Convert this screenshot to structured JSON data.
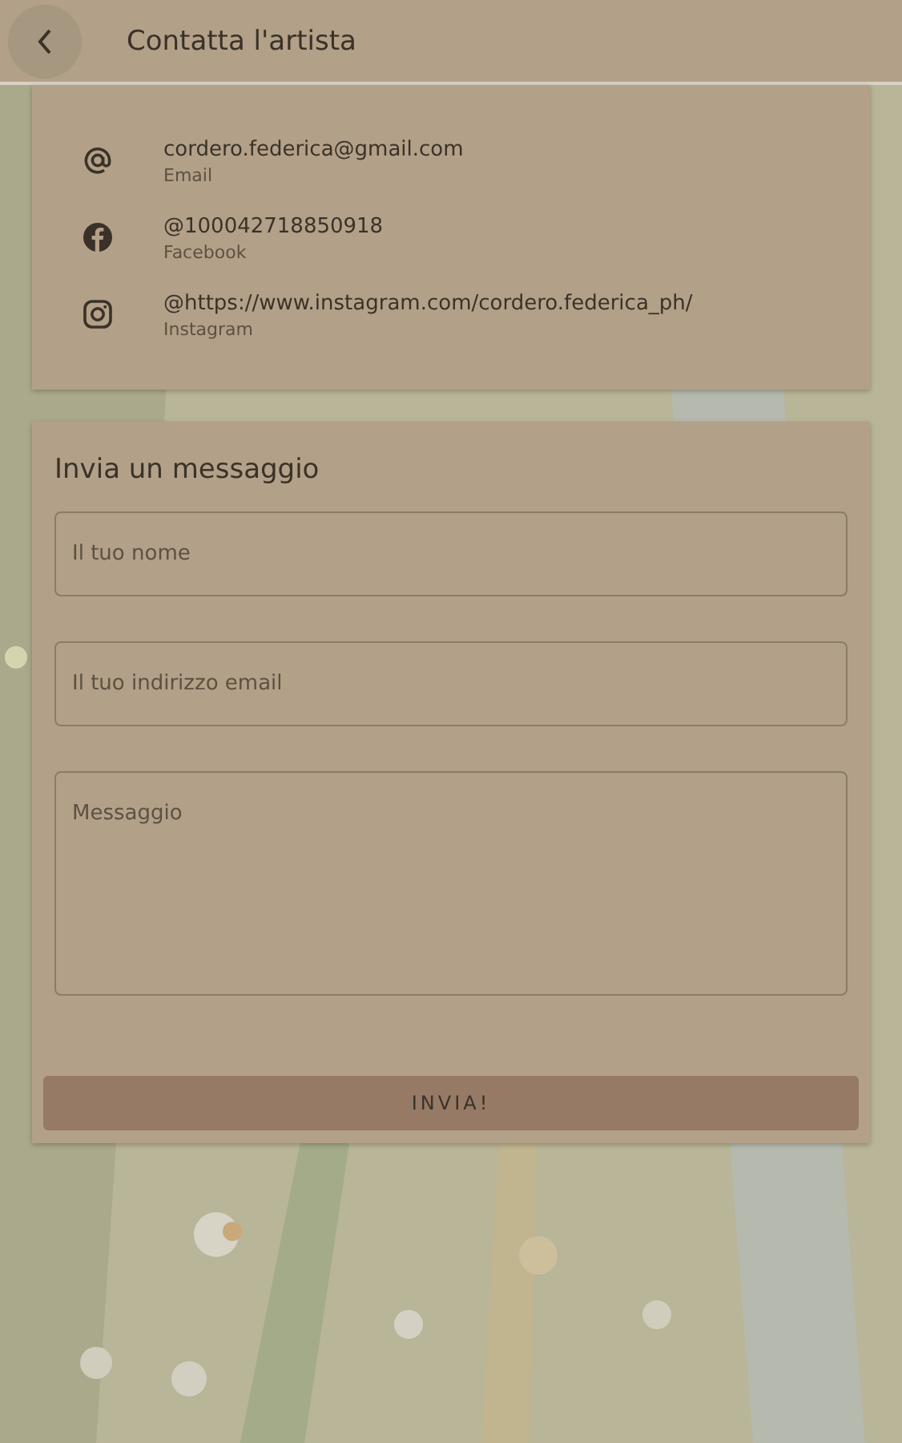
{
  "header": {
    "title": "Contatta l'artista"
  },
  "contacts": [
    {
      "kind": "email",
      "value": "cordero.federica@gmail.com",
      "label": "Email"
    },
    {
      "kind": "facebook",
      "value": "@100042718850918",
      "label": "Facebook"
    },
    {
      "kind": "instagram",
      "value": "@https://www.instagram.com/cordero.federica_ph/",
      "label": "Instagram"
    }
  ],
  "form": {
    "title": "Invia un messaggio",
    "fields": [
      {
        "kind": "input",
        "placeholder": "Il tuo nome"
      },
      {
        "kind": "input",
        "placeholder": "Il tuo indirizzo email"
      },
      {
        "kind": "textarea",
        "placeholder": "Messaggio"
      }
    ],
    "submit": "INVIA!"
  }
}
